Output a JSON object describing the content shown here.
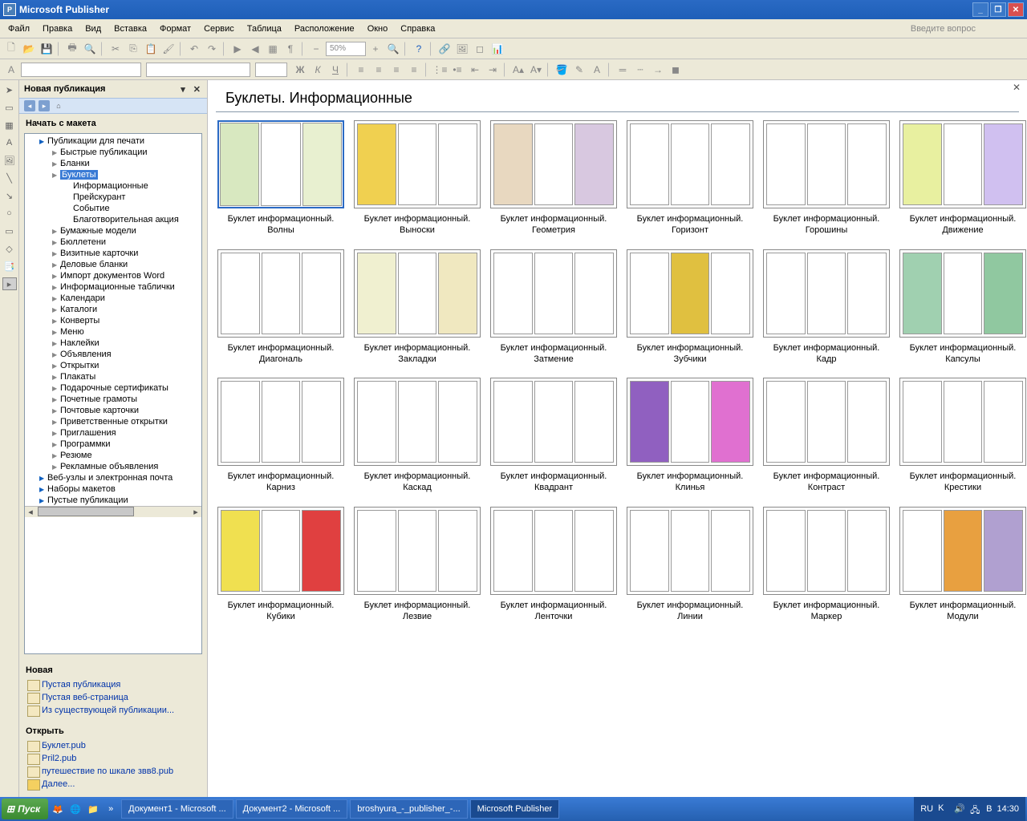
{
  "window": {
    "title": "Microsoft Publisher"
  },
  "menu": [
    "Файл",
    "Правка",
    "Вид",
    "Вставка",
    "Формат",
    "Сервис",
    "Таблица",
    "Расположение",
    "Окно",
    "Справка"
  ],
  "ask_prompt": "Введите вопрос",
  "zoom": "50%",
  "task_pane": {
    "title": "Новая публикация",
    "section": "Начать с макета",
    "tree": [
      {
        "label": "Публикации для печати",
        "depth": 1,
        "arrow": "blue",
        "expanded": true
      },
      {
        "label": "Быстрые публикации",
        "depth": 2,
        "arrow": "g"
      },
      {
        "label": "Бланки",
        "depth": 2,
        "arrow": "g"
      },
      {
        "label": "Буклеты",
        "depth": 2,
        "arrow": "g",
        "selected": true
      },
      {
        "label": "Информационные",
        "depth": 3
      },
      {
        "label": "Прейскурант",
        "depth": 3
      },
      {
        "label": "Событие",
        "depth": 3
      },
      {
        "label": "Благотворительная акция",
        "depth": 3
      },
      {
        "label": "Бумажные модели",
        "depth": 2,
        "arrow": "g"
      },
      {
        "label": "Бюллетени",
        "depth": 2,
        "arrow": "g"
      },
      {
        "label": "Визитные карточки",
        "depth": 2,
        "arrow": "g"
      },
      {
        "label": "Деловые бланки",
        "depth": 2,
        "arrow": "g"
      },
      {
        "label": "Импорт документов Word",
        "depth": 2,
        "arrow": "g"
      },
      {
        "label": "Информационные таблички",
        "depth": 2,
        "arrow": "g"
      },
      {
        "label": "Календари",
        "depth": 2,
        "arrow": "g"
      },
      {
        "label": "Каталоги",
        "depth": 2,
        "arrow": "g"
      },
      {
        "label": "Конверты",
        "depth": 2,
        "arrow": "g"
      },
      {
        "label": "Меню",
        "depth": 2,
        "arrow": "g"
      },
      {
        "label": "Наклейки",
        "depth": 2,
        "arrow": "g"
      },
      {
        "label": "Объявления",
        "depth": 2,
        "arrow": "g"
      },
      {
        "label": "Открытки",
        "depth": 2,
        "arrow": "g"
      },
      {
        "label": "Плакаты",
        "depth": 2,
        "arrow": "g"
      },
      {
        "label": "Подарочные сертификаты",
        "depth": 2,
        "arrow": "g"
      },
      {
        "label": "Почетные грамоты",
        "depth": 2,
        "arrow": "g"
      },
      {
        "label": "Почтовые карточки",
        "depth": 2,
        "arrow": "g"
      },
      {
        "label": "Приветственные открытки",
        "depth": 2,
        "arrow": "g"
      },
      {
        "label": "Приглашения",
        "depth": 2,
        "arrow": "g"
      },
      {
        "label": "Программки",
        "depth": 2,
        "arrow": "g"
      },
      {
        "label": "Резюме",
        "depth": 2,
        "arrow": "g"
      },
      {
        "label": "Рекламные объявления",
        "depth": 2,
        "arrow": "g"
      },
      {
        "label": "Веб-узлы и электронная почта",
        "depth": 1,
        "arrow": "blue"
      },
      {
        "label": "Наборы макетов",
        "depth": 1,
        "arrow": "blue"
      },
      {
        "label": "Пустые публикации",
        "depth": 1,
        "arrow": "blue"
      }
    ],
    "new_section": "Новая",
    "new_links": [
      "Пустая публикация",
      "Пустая веб-страница",
      "Из существующей публикации..."
    ],
    "open_section": "Открыть",
    "open_links": [
      "Буклет.pub",
      "Pril2.pub",
      "путешествие по шкале звв8.pub",
      "Далее..."
    ]
  },
  "gallery": {
    "title": "Буклеты. Информационные",
    "items": [
      "Буклет информационный. Волны",
      "Буклет информационный. Выноски",
      "Буклет информационный. Геометрия",
      "Буклет информационный. Горизонт",
      "Буклет информационный. Горошины",
      "Буклет информационный. Движение",
      "Буклет информационный. Диагональ",
      "Буклет информационный. Закладки",
      "Буклет информационный. Затмение",
      "Буклет информационный. Зубчики",
      "Буклет информационный. Кадр",
      "Буклет информационный. Капсулы",
      "Буклет информационный. Карниз",
      "Буклет информационный. Каскад",
      "Буклет информационный. Квадрант",
      "Буклет информационный. Клинья",
      "Буклет информационный. Контраст",
      "Буклет информационный. Крестики",
      "Буклет информационный. Кубики",
      "Буклет информационный. Лезвие",
      "Буклет информационный. Ленточки",
      "Буклет информационный. Линии",
      "Буклет информационный. Маркер",
      "Буклет информационный. Модули"
    ]
  },
  "taskbar": {
    "start": "Пуск",
    "items": [
      "Документ1 - Microsoft ...",
      "Документ2 - Microsoft ...",
      "broshyura_-_publisher_-...",
      "Microsoft Publisher"
    ],
    "lang": "RU",
    "clock": "14:30",
    "day": "В"
  }
}
